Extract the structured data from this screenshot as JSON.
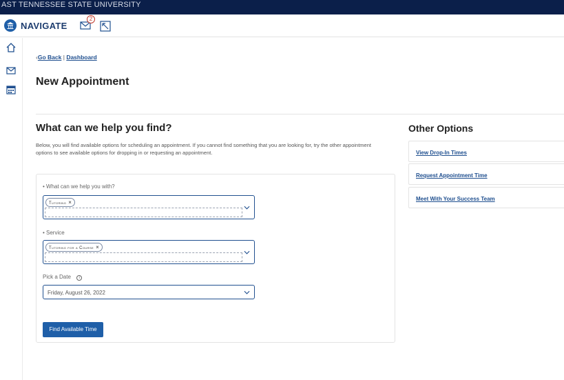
{
  "topbar": {
    "university": "AST TENNESSEE STATE UNIVERSITY"
  },
  "header": {
    "app_name": "NAVIGATE",
    "mail_badge_count": "2"
  },
  "breadcrumb": {
    "back": "Go Back",
    "separator": "|",
    "dashboard": "Dashboard"
  },
  "page": {
    "title": "New Appointment"
  },
  "help_section": {
    "title": "What can we help you find?",
    "description": "Below, you will find available options for scheduling an appointment. If you cannot find something that you are looking for, try the other appointment options to see available options for dropping in or requesting an appointment."
  },
  "form": {
    "help_with": {
      "label": "• What can we help you with?",
      "tag": "Tutoring"
    },
    "service": {
      "label": "• Service",
      "tag": "Tutoring for a Course"
    },
    "date": {
      "label": "Pick a Date",
      "value": "Friday, August 26, 2022"
    },
    "find_button": "Find Available Time"
  },
  "other_options": {
    "title": "Other Options",
    "items": [
      {
        "label": "View Drop-In Times"
      },
      {
        "label": "Request Appointment Time"
      },
      {
        "label": "Meet With Your Success Team"
      }
    ]
  },
  "icons": {
    "logo": "university-building-icon",
    "mail": "mail-icon",
    "flag": "flag-icon",
    "home": "home-icon",
    "envelope": "envelope-icon",
    "calendar": "calendar-icon",
    "info": "info-icon",
    "chevron": "chevron-down-icon",
    "remove": "close-icon"
  },
  "colors": {
    "topbar": "#0b1f4a",
    "accent": "#1f5fa8",
    "link": "#1f4f8f",
    "badge": "#c0392b"
  }
}
